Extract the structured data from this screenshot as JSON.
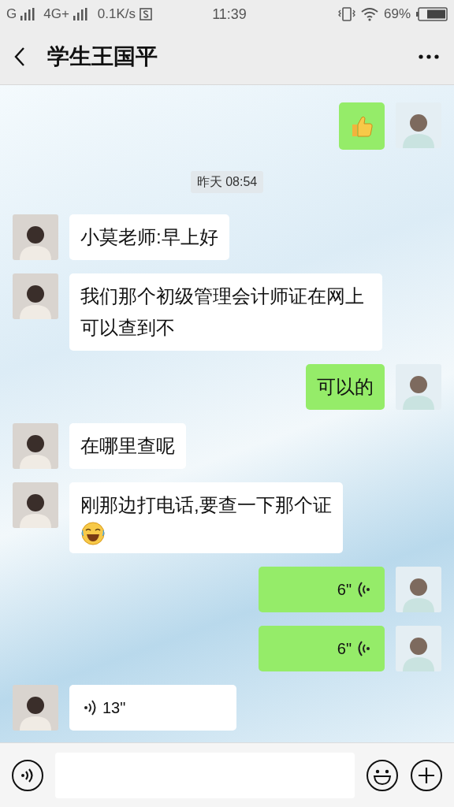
{
  "status_bar": {
    "network_1": "G",
    "network_2": "4G+",
    "speed": "0.1K/s",
    "time": "11:39",
    "battery": "69%"
  },
  "header": {
    "title": "学生王国平"
  },
  "messages": [
    {
      "kind": "sticker",
      "sent": true
    },
    {
      "kind": "timestamp",
      "text": "昨天 08:54"
    },
    {
      "kind": "text",
      "sent": false,
      "text": "小莫老师:早上好"
    },
    {
      "kind": "text",
      "sent": false,
      "text": "我们那个初级管理会计师证在网上可以查到不"
    },
    {
      "kind": "text",
      "sent": true,
      "text": "可以的"
    },
    {
      "kind": "text",
      "sent": false,
      "text": "在哪里查呢"
    },
    {
      "kind": "text",
      "sent": false,
      "text": "刚那边打电话,要查一下那个证",
      "emoji": true
    },
    {
      "kind": "voice",
      "sent": true,
      "text": "6\""
    },
    {
      "kind": "voice",
      "sent": true,
      "text": "6\""
    },
    {
      "kind": "voice",
      "sent": false,
      "text": "13\""
    }
  ]
}
